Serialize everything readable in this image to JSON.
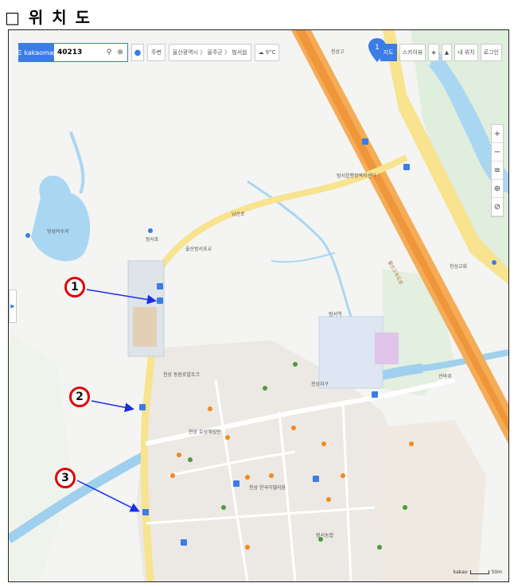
{
  "heading": "□ 위 치 도",
  "toolbar": {
    "menu_label": "kakaomap",
    "search_value": "40213",
    "btn_route": "주변",
    "breadcrumb": "울산광역시 〉 울주군 〉 범서읍",
    "btn_temp": "9°C"
  },
  "rightbar": {
    "items": [
      "지도",
      "스카이뷰",
      "",
      "",
      "내 위치",
      "로그인"
    ]
  },
  "zoom": [
    "+",
    "−",
    "≡",
    "⊕",
    "⊘"
  ],
  "scale_label": "kakao",
  "scale_unit": "50m",
  "markers": [
    "1",
    "2",
    "3"
  ],
  "place_labels": {
    "park_pond": "망성저수지",
    "school_north": "범서초",
    "apt_top": "천상고",
    "highway": "울산고속도로",
    "station": "범서역",
    "road_main": "남산로",
    "office": "범서읍행정복지센터",
    "apt_a": "천상 동원로얄듀크",
    "apt_b": "천상 한국아델리움",
    "apt_c": "천상 효성해링턴",
    "school_mid": "울산범서초교",
    "mart": "범서농협",
    "hill": "천상지구",
    "river": "선바위",
    "church": "천상교회"
  },
  "colors": {
    "accent": "#3b7ce6",
    "marker": "#e20000",
    "arrow": "#1a2ee8"
  }
}
